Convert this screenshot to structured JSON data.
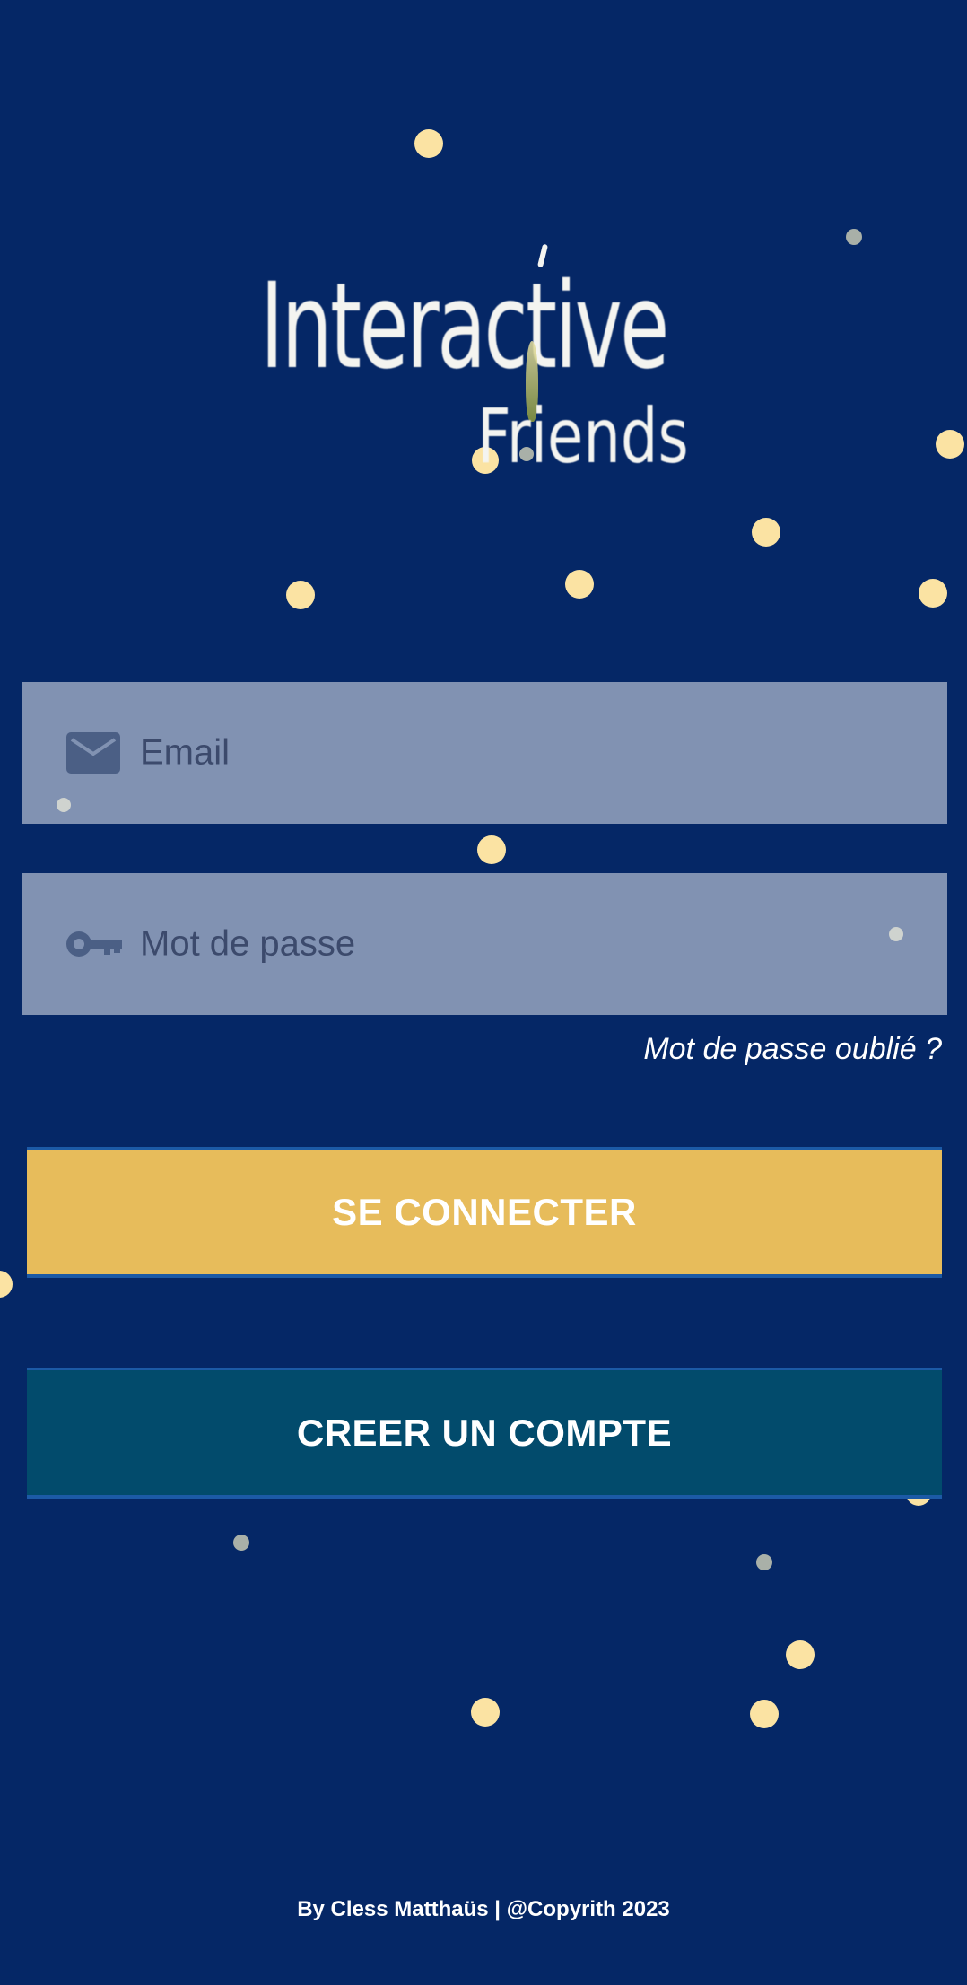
{
  "logo": {
    "line1": "Interactive",
    "line2": "Friends"
  },
  "form": {
    "email_placeholder": "Email",
    "email_icon": "envelope-icon",
    "password_placeholder": "Mot de passe",
    "password_icon": "key-icon",
    "forgot_password": "Mot de passe oublié ?"
  },
  "buttons": {
    "login_label": "SE CONNECTER",
    "signup_label": "CREER UN COMPTE"
  },
  "footer": {
    "text": "By Cless Matthaüs | @Copyrith 2023"
  },
  "colors": {
    "background": "#052766",
    "field": "#8192b2",
    "login_button": "#e7bc5b",
    "signup_button": "#024b6c",
    "dot": "#fbe3a3"
  }
}
